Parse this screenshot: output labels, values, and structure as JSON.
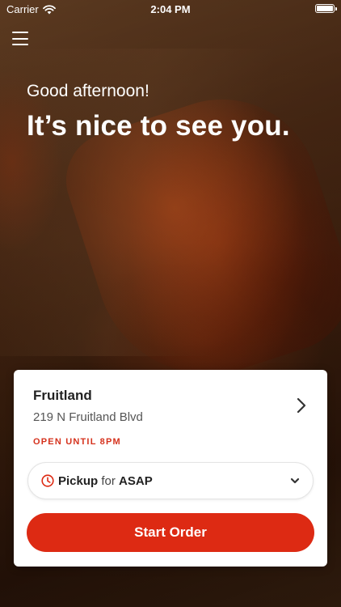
{
  "status_bar": {
    "carrier": "Carrier",
    "time": "2:04 PM"
  },
  "hero": {
    "greeting": "Good afternoon!",
    "welcome": "It’s nice to see you."
  },
  "store": {
    "name": "Fruitland",
    "address": "219 N Fruitland Blvd",
    "hours": "OPEN UNTIL 8PM"
  },
  "order": {
    "mode": "Pickup",
    "for_label": "for",
    "time": "ASAP",
    "start_label": "Start Order"
  },
  "colors": {
    "accent": "#dd2a13",
    "hours_text": "#d5321d"
  },
  "icons": {
    "menu": "hamburger-menu-icon",
    "wifi": "wifi-icon",
    "battery": "battery-icon",
    "store_chevron": "chevron-right-icon",
    "clock": "clock-icon",
    "dropdown": "chevron-down-icon"
  }
}
